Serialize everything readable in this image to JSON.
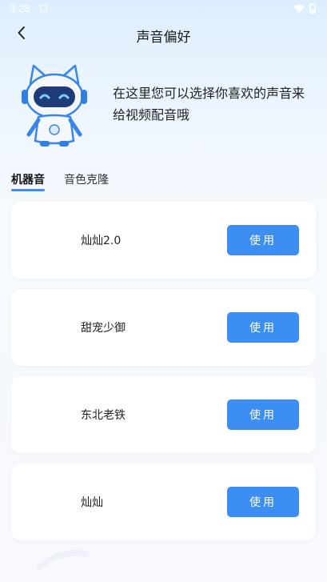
{
  "status_bar": {
    "time": "3:28",
    "icons": [
      "notification-icon",
      "wifi-icon",
      "battery-icon"
    ]
  },
  "nav": {
    "title": "声音偏好",
    "back_icon": "chevron-left-icon"
  },
  "hero": {
    "text": "在这里您可以选择你喜欢的声音来给视频配音哦",
    "mascot": "robot-cat-mascot"
  },
  "tabs": [
    {
      "label": "机器音",
      "active": true
    },
    {
      "label": "音色克隆",
      "active": false
    }
  ],
  "voices": [
    {
      "name": "灿灿2.0",
      "button_label": "使用"
    },
    {
      "name": "甜宠少御",
      "button_label": "使用"
    },
    {
      "name": "东北老铁",
      "button_label": "使用"
    },
    {
      "name": "灿灿",
      "button_label": "使用"
    }
  ],
  "colors": {
    "accent": "#3c8ef3",
    "card": "#ffffff",
    "text": "#222222"
  }
}
